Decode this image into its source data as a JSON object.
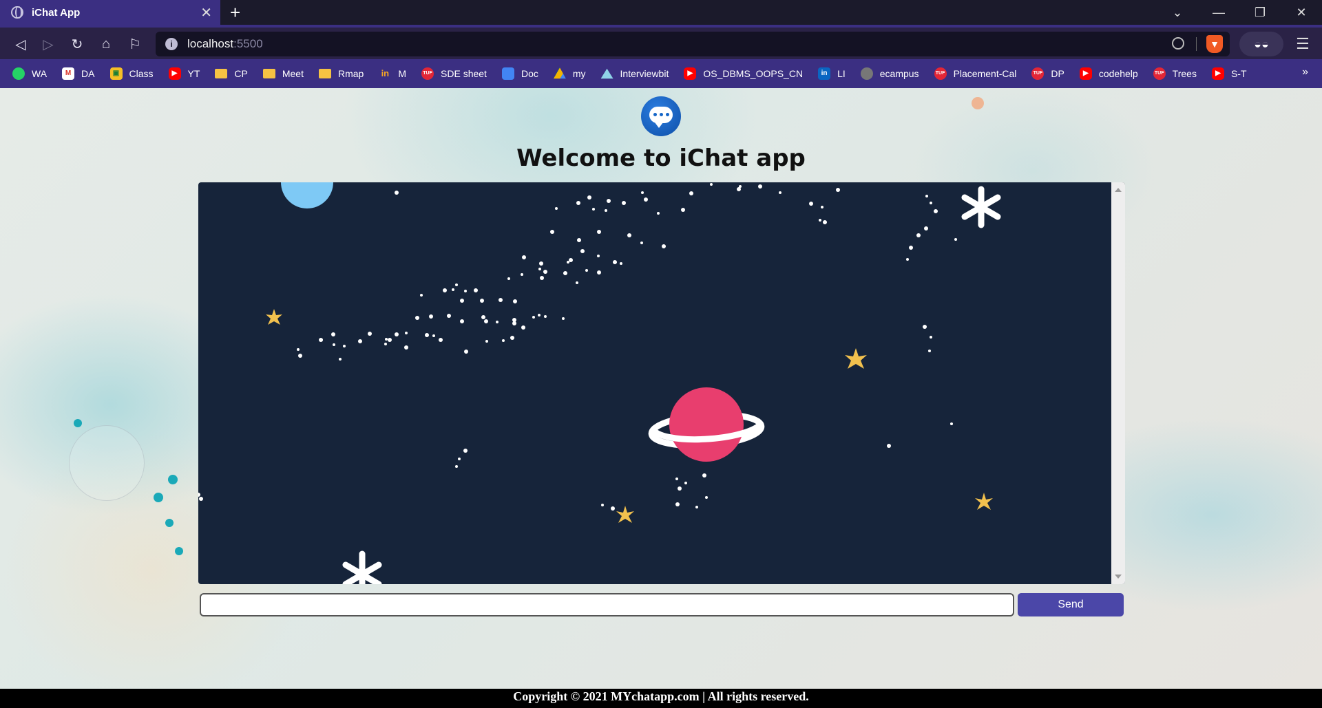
{
  "browser": {
    "tab_title": "iChat App",
    "url_host": "localhost",
    "url_port": ":5500",
    "bookmarks": [
      {
        "label": "WA",
        "icon": "whatsapp-icon"
      },
      {
        "label": "DA",
        "icon": "gmail-icon"
      },
      {
        "label": "Class",
        "icon": "classroom-icon"
      },
      {
        "label": "YT",
        "icon": "youtube-icon"
      },
      {
        "label": "CP",
        "icon": "folder-icon"
      },
      {
        "label": "Meet",
        "icon": "folder-icon"
      },
      {
        "label": "Rmap",
        "icon": "folder-icon"
      },
      {
        "label": "M",
        "icon": "m-icon"
      },
      {
        "label": "SDE sheet",
        "icon": "tuf-icon"
      },
      {
        "label": "Doc",
        "icon": "docs-icon"
      },
      {
        "label": "my",
        "icon": "drive-icon"
      },
      {
        "label": "Interviewbit",
        "icon": "interviewbit-icon"
      },
      {
        "label": "OS_DBMS_OOPS_CN",
        "icon": "youtube-icon"
      },
      {
        "label": "LI",
        "icon": "linkedin-icon"
      },
      {
        "label": "ecampus",
        "icon": "globe-icon"
      },
      {
        "label": "Placement-Cal",
        "icon": "tuf-icon"
      },
      {
        "label": "DP",
        "icon": "tuf-icon"
      },
      {
        "label": "codehelp",
        "icon": "youtube-icon"
      },
      {
        "label": "Trees",
        "icon": "tuf-icon"
      },
      {
        "label": "S-T",
        "icon": "youtube-icon"
      }
    ]
  },
  "page": {
    "heading": "Welcome to iChat app",
    "message_input": {
      "value": "",
      "placeholder": ""
    },
    "send_label": "Send",
    "footer": "Copyright © 2021 MYchatapp.com | All rights reserved."
  },
  "colors": {
    "tab_active": "#3b2f82",
    "send_button": "#4b47a8",
    "chat_background": "#16243a",
    "planet": "#e83e6e"
  }
}
